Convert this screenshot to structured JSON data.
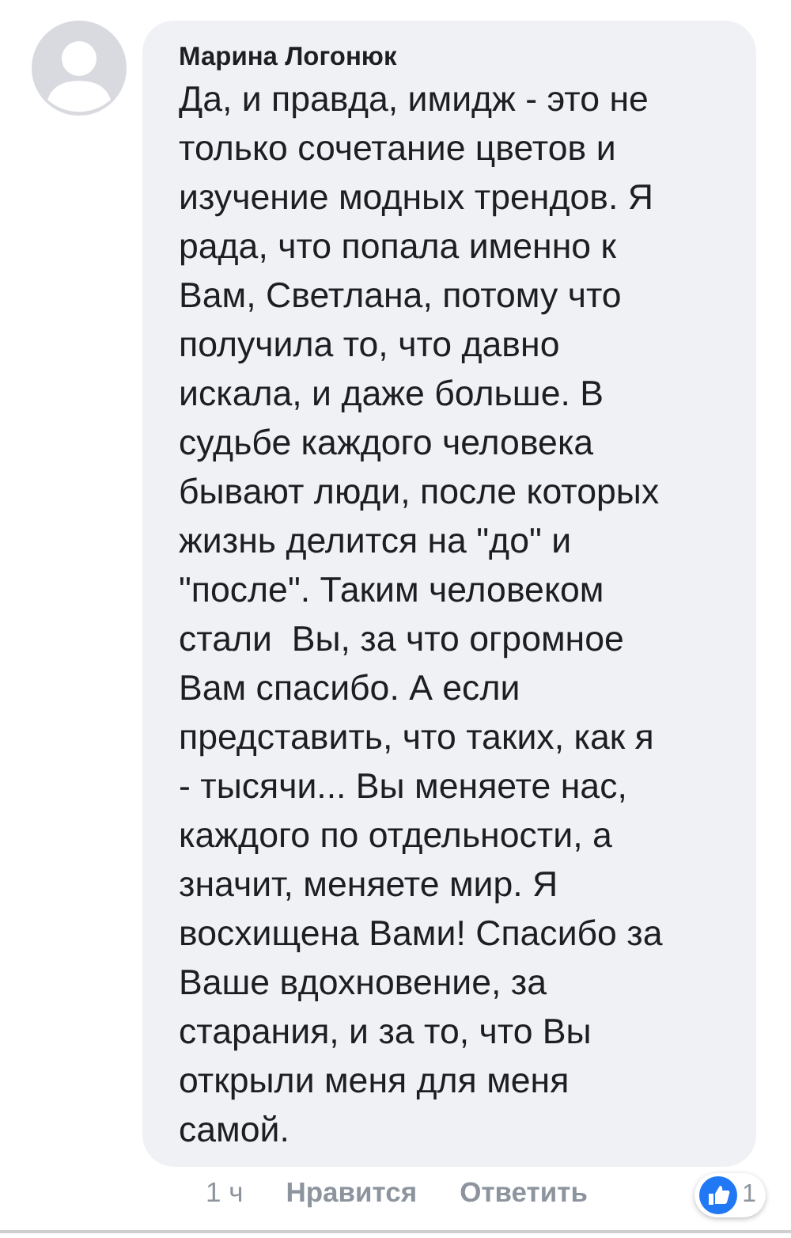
{
  "comment": {
    "author": "Марина Логонюк",
    "text": "Да, и правда, имидж - это не\nтолько сочетание цветов и\nизучение модных трендов. Я\nрада, что попала именно к\nВам, Светлана, потому что\nполучила то, что давно\nискала, и даже больше. В\nсудьбе каждого человека\nбывают люди, после которых\nжизнь делится на \"до\" и\n\"после\". Таким человеком\nстали  Вы, за что огромное\nВам спасибо. А если\nпредставить, что таких, как я\n- тысячи... Вы меняете нас,\nкаждого по отдельности, а\nзначит, меняете мир. Я\nвосхищена Вами! Спасибо за\nВаше вдохновение, за\nстарания, и за то, что Вы\nоткрыли меня для меня\nсамой.",
    "time": "1 ч",
    "actions": [
      "Нравится",
      "Ответить"
    ],
    "like_count": "1"
  }
}
